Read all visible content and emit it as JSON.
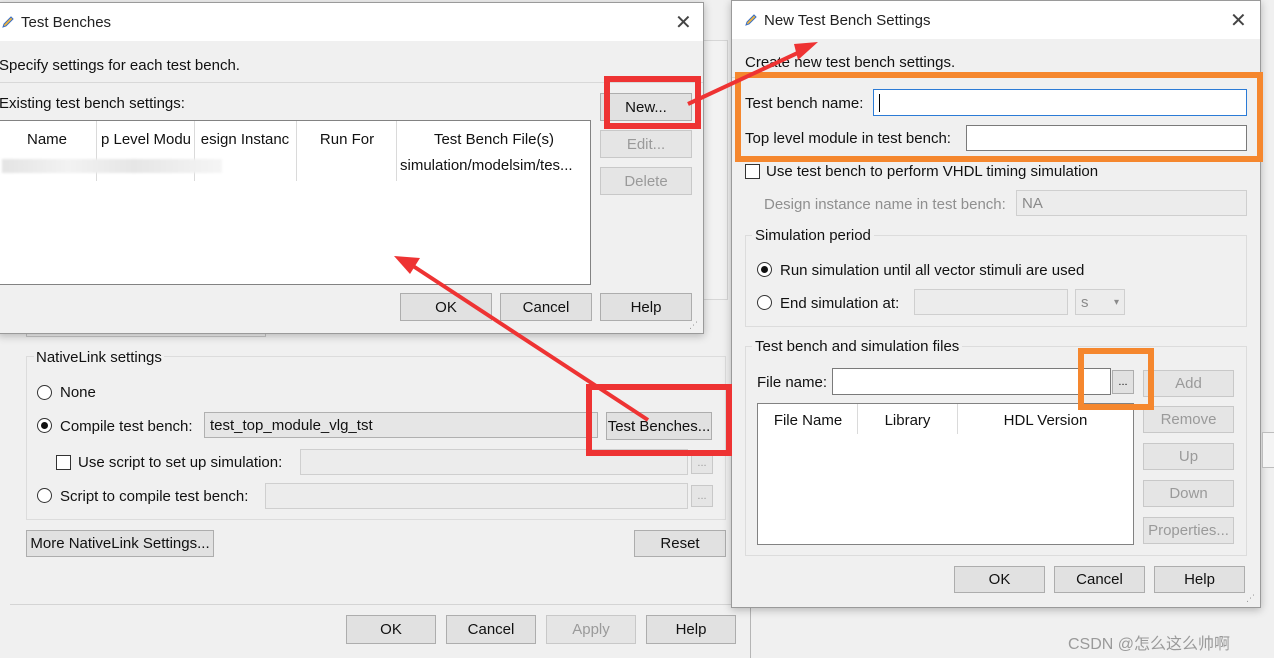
{
  "background_dialog": {
    "nativelink_group": "NativeLink settings",
    "none_label": "None",
    "compile_label": "Compile test bench:",
    "compile_value": "test_top_module_vlg_tst",
    "test_benches_button": "Test Benches...",
    "use_script_label": "Use script to set up simulation:",
    "script_compile_label": "Script to compile test bench:",
    "browse1": "...",
    "browse2": "...",
    "more_settings_button": "More NativeLink Settings...",
    "reset_button": "Reset",
    "ok_button": "OK",
    "cancel_button": "Cancel",
    "apply_button": "Apply",
    "help_button": "Help"
  },
  "test_benches_dialog": {
    "title": "Test Benches",
    "instruction": "Specify settings for each test bench.",
    "existing_label": "Existing test bench settings:",
    "columns": [
      "Name",
      "p Level Modu",
      "esign Instanc",
      "Run For",
      "Test Bench File(s)"
    ],
    "row_file": "simulation/modelsim/tes...",
    "new_button": "New...",
    "edit_button": "Edit...",
    "delete_button": "Delete",
    "ok_button": "OK",
    "cancel_button": "Cancel",
    "help_button": "Help"
  },
  "new_settings_dialog": {
    "title": "New Test Bench Settings",
    "instruction": "Create new test bench settings.",
    "name_label": "Test bench name:",
    "name_value": "",
    "top_label": "Top level module in test bench:",
    "top_value": "",
    "vhdl_timing_label": "Use test bench to perform VHDL timing simulation",
    "design_instance_label": "Design instance name in test bench:",
    "design_instance_value": "NA",
    "sim_period_group": "Simulation period",
    "run_until_label": "Run simulation until all vector stimuli are used",
    "end_at_label": "End simulation at:",
    "end_unit": "s",
    "files_group": "Test bench and simulation files",
    "file_name_label": "File name:",
    "browse": "...",
    "add_button": "Add",
    "remove_button": "Remove",
    "up_button": "Up",
    "down_button": "Down",
    "properties_button": "Properties...",
    "file_columns": [
      "File Name",
      "Library",
      "HDL Version"
    ],
    "ok_button": "OK",
    "cancel_button": "Cancel",
    "help_button": "Help"
  },
  "watermark": "CSDN @怎么这么帅啊",
  "colors": {
    "red_highlight": "#ee3333",
    "orange_highlight": "#f5872e"
  }
}
